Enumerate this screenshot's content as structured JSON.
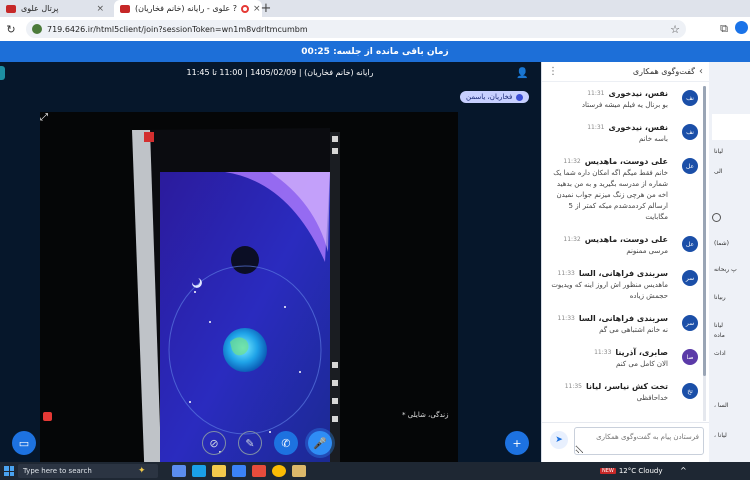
{
  "browser": {
    "tabs": [
      {
        "label": "پرتال علوی"
      },
      {
        "label": "علوی - رایانه (خانم فخاریان) ?"
      }
    ],
    "url": "719.6426.ir/html5client/join?sessionToken=wn1m8vdrltmcumbm"
  },
  "timer": {
    "label": "زمان باقی مانده از جلسه: 00:25"
  },
  "meeting": {
    "title": "رایانه (خانم فخاریان) | 1405/02/09 | 11:00 تا 11:45",
    "presenter": "فخاریان، یاسمن",
    "video_caption": "* زندگی، شایلی"
  },
  "chat": {
    "header": "گفت‌وگوی همکاری",
    "input_placeholder": "فرستادن پیام به گفت‌وگوی همکاری",
    "messages": [
      {
        "avatar": "نف",
        "name": "نفس، نیدخوری",
        "time": "11:31",
        "text": "بو برنال یه فیلم میشه فرستاد"
      },
      {
        "avatar": "نف",
        "name": "نفس، نیدخوری",
        "time": "11:31",
        "text": "باسه خانم"
      },
      {
        "avatar": "عل",
        "name": "علی دوست، ماهدیس",
        "time": "11:32",
        "text": "خانم فقط میگم اگه امکان داره شما یک شماره از مدرسه بگیرید و به من بدهید اخه من هرچی زنگ میزنم جواب نمیدن ارسالم کردمدشدم میکه کمتر از 5 مگابایت"
      },
      {
        "avatar": "عل",
        "name": "علی دوست، ماهدیس",
        "time": "11:32",
        "text": "مرسی ممنونم"
      },
      {
        "avatar": "سر",
        "name": "سربندی فراهانی، السا",
        "time": "11:33",
        "text": "ماهدیس منظور اش اروز اینه که ویدیوت حجمش زیاده"
      },
      {
        "avatar": "سر",
        "name": "سربندی فراهانی، السا",
        "time": "11:33",
        "text": "نه خانم اشتباهی می گم"
      },
      {
        "avatar": "صا",
        "name": "صابری، آذرینا",
        "time": "11:33",
        "text": "الان کامل می کنم"
      },
      {
        "avatar": "تخ",
        "name": "تخت کش نیاسر، لیانا",
        "time": "11:35",
        "text": "خداحافظی"
      }
    ]
  },
  "participants_partial": [
    "لیانا",
    "الی",
    "(شما)",
    "پ ربحانه",
    "ربیانا",
    "لیانا",
    "ماده",
    "ادات",
    "، السا",
    "، لیانا"
  ],
  "taskbar": {
    "search": "Type here to search",
    "weather": "12°C  Cloudy",
    "weather_badge": "NEW"
  },
  "colors": {
    "timer_bar": "#1d6fd8",
    "meeting_bg": "#06172b",
    "accent": "#2f8df5"
  }
}
